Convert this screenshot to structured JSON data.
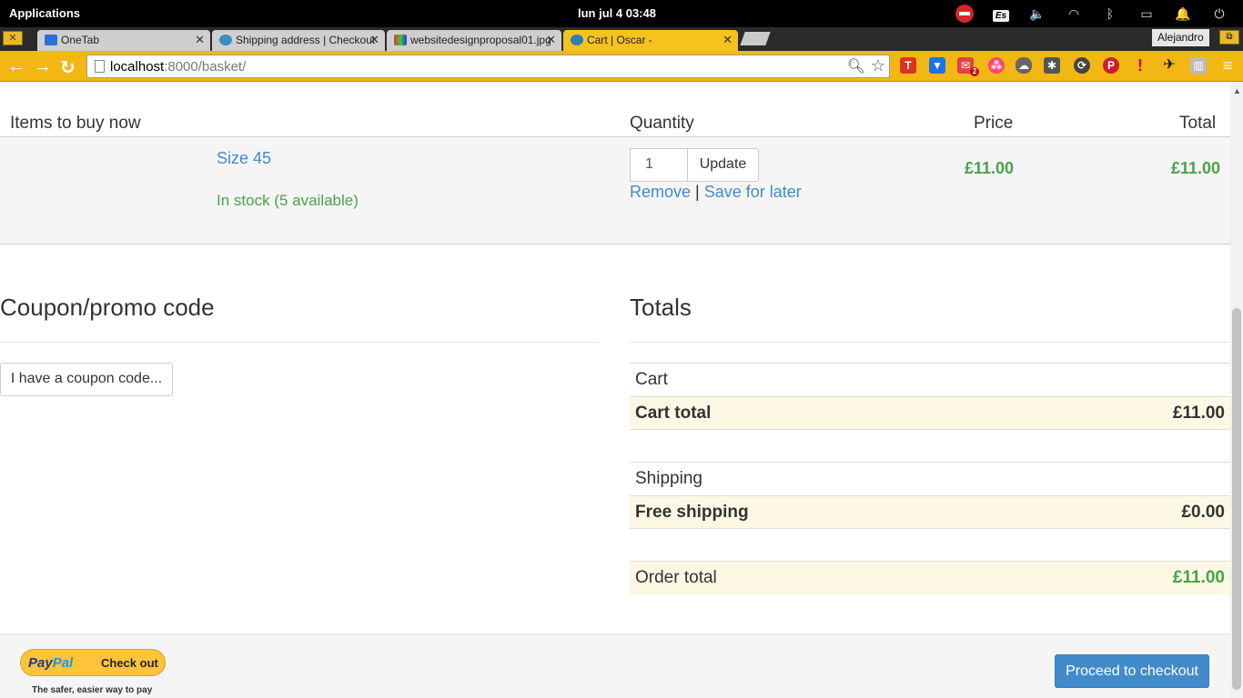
{
  "desktop": {
    "applications_label": "Applications",
    "clock": "lun jul  4   03:48",
    "keyboard_layout": "Es"
  },
  "browser": {
    "tabs": [
      {
        "title": "OneTab",
        "active": false
      },
      {
        "title": "Shipping address | Checkout",
        "active": false
      },
      {
        "title": "websitedesignproposal01.jpg",
        "active": false
      },
      {
        "title": "Cart | Oscar -",
        "active": true
      }
    ],
    "profile_name": "Alejandro",
    "url_host": "localhost",
    "url_path": ":8000/basket/",
    "mail_badge": "2"
  },
  "basket": {
    "headers": {
      "items": "Items to buy now",
      "quantity": "Quantity",
      "price": "Price",
      "total": "Total"
    },
    "line": {
      "variant": "Size 45",
      "availability": "In stock (5 available)",
      "quantity": "1",
      "update_label": "Update",
      "remove_label": "Remove",
      "separator": "|",
      "save_label": "Save for later",
      "price": "£11.00",
      "total": "£11.00"
    }
  },
  "coupon": {
    "heading": "Coupon/promo code",
    "button_label": "I have a coupon code..."
  },
  "totals": {
    "heading": "Totals",
    "cart_label": "Cart",
    "cart_total_label": "Cart total",
    "cart_total_value": "£11.00",
    "shipping_label": "Shipping",
    "shipping_method_label": "Free shipping",
    "shipping_value": "£0.00",
    "order_total_label": "Order total",
    "order_total_value": "£11.00"
  },
  "footer": {
    "paypal_brand_a": "Pay",
    "paypal_brand_b": "Pal",
    "paypal_checkout": "Check out",
    "paypal_tagline": "The safer, easier way to pay",
    "proceed_label": "Proceed to checkout"
  },
  "colors": {
    "link": "#428bca",
    "success": "#47a447",
    "warning_row": "#fcf8e3",
    "chrome_theme": "#f2b713"
  }
}
